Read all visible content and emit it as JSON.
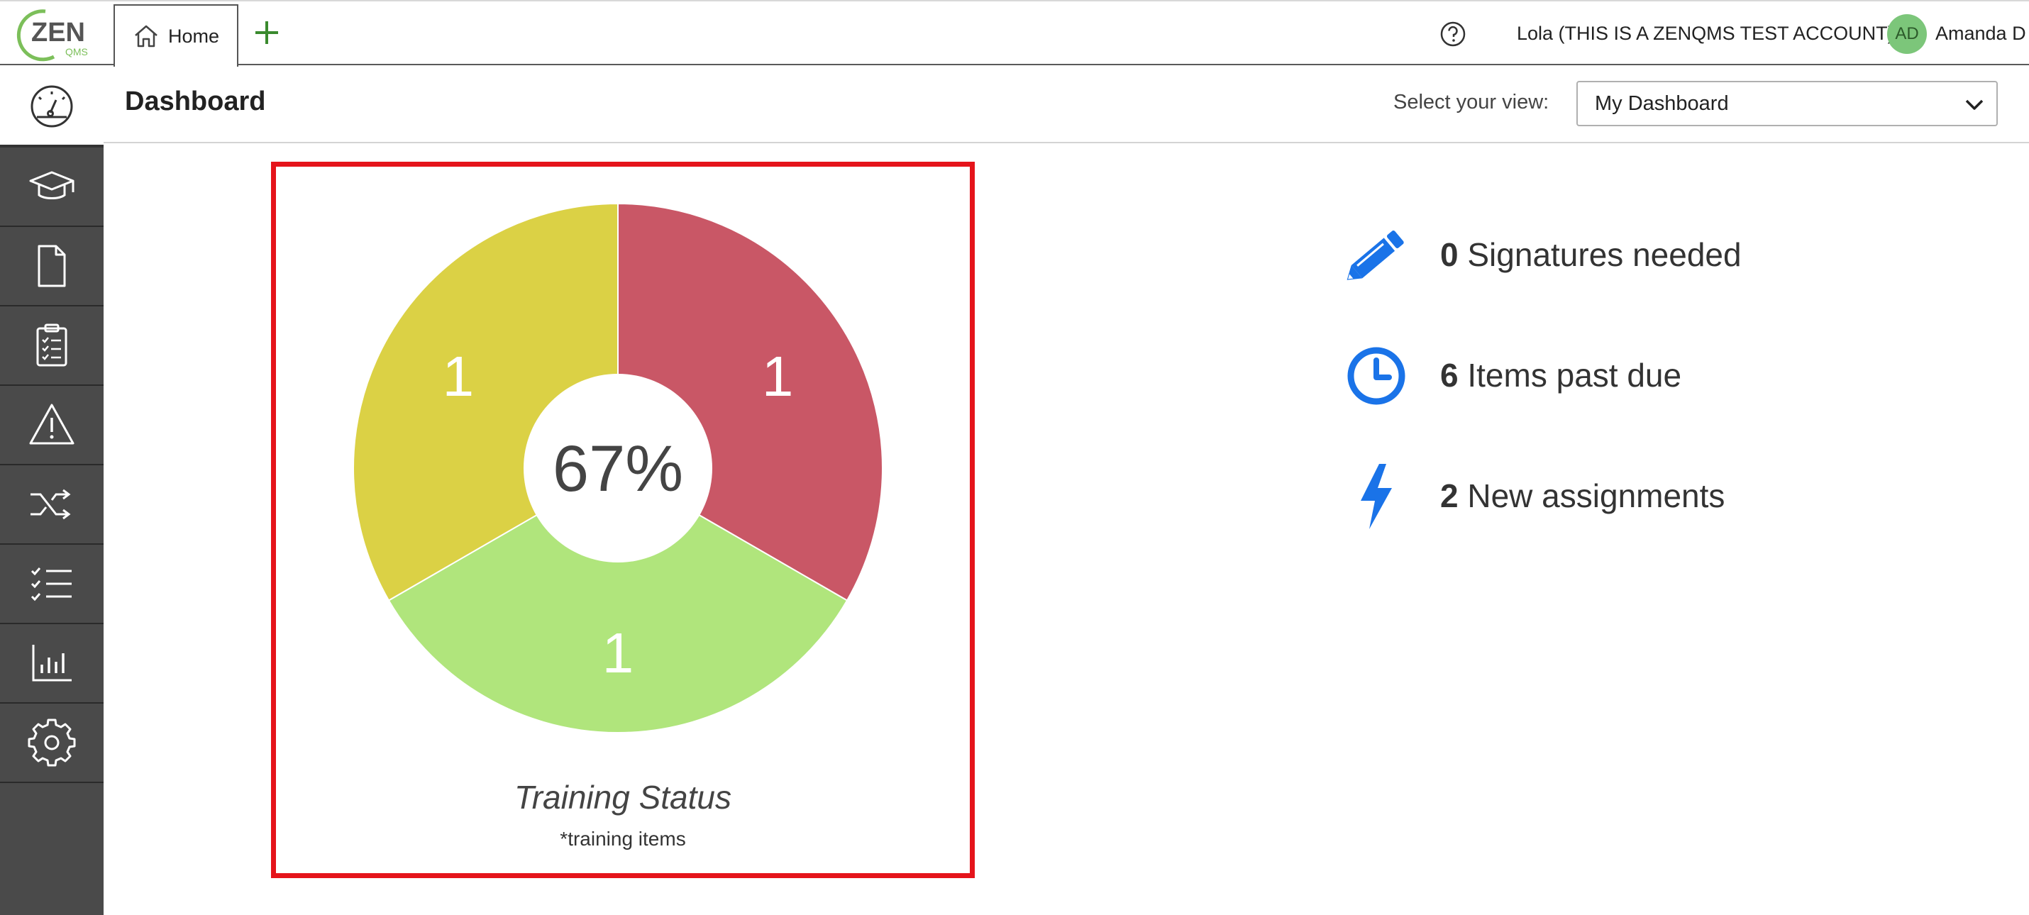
{
  "topbar": {
    "logo_text": "ZEN",
    "logo_sub": "QMS",
    "tab_home_label": "Home",
    "account_label": "Lola (THIS IS A ZENQMS TEST ACCOUNT)",
    "avatar_initials": "AD",
    "user_name": "Amanda D"
  },
  "sidebar": {
    "items": [
      {
        "icon": "dashboard-icon"
      },
      {
        "icon": "training-cap-icon"
      },
      {
        "icon": "document-icon"
      },
      {
        "icon": "clipboard-checklist-icon"
      },
      {
        "icon": "warning-icon"
      },
      {
        "icon": "shuffle-icon"
      },
      {
        "icon": "checklist-icon"
      },
      {
        "icon": "bar-chart-icon"
      },
      {
        "icon": "gear-icon"
      }
    ]
  },
  "header": {
    "title": "Dashboard",
    "view_label": "Select your view:",
    "view_selected": "My Dashboard"
  },
  "chart_data": {
    "type": "pie",
    "donut": true,
    "title": "Training Status",
    "subtitle": "*training items",
    "center_label": "67%",
    "slices": [
      {
        "value": 1,
        "label": "1",
        "color": "#c95766"
      },
      {
        "value": 1,
        "label": "1",
        "color": "#b0e57c"
      },
      {
        "value": 1,
        "label": "1",
        "color": "#dbd145"
      }
    ]
  },
  "stats": [
    {
      "icon": "pencil-icon",
      "count": "0",
      "label": "Signatures needed",
      "color": "#1a73e8"
    },
    {
      "icon": "clock-icon",
      "count": "6",
      "label": "Items past due",
      "color": "#1a73e8"
    },
    {
      "icon": "lightning-icon",
      "count": "2",
      "label": "New assignments",
      "color": "#1a73e8"
    }
  ],
  "colors": {
    "highlight_border": "#e5141b",
    "sidebar_bg": "#4a4a4a",
    "accent_green": "#3a8a2e"
  }
}
